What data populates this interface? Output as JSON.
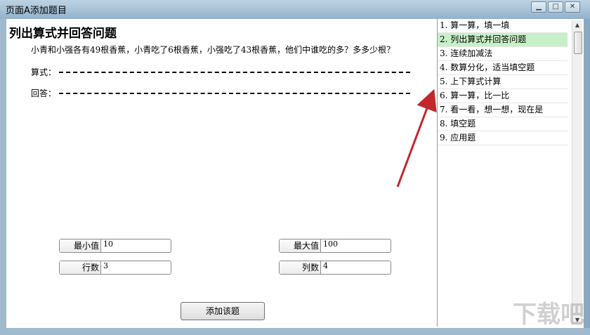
{
  "window": {
    "title": "页面A添加题目"
  },
  "question": {
    "title": "列出算式并回答问题",
    "text": "小青和小强各有49根香蕉，小青吃了6根香蕉，小强吃了43根香蕉，他们中谁吃的多？多多少根？",
    "formula_label": "算式：",
    "answer_label": "回答："
  },
  "params": {
    "min": {
      "label": "最小值",
      "value": "10"
    },
    "max": {
      "label": "最大值",
      "value": "100"
    },
    "rows": {
      "label": "行数",
      "value": "3"
    },
    "cols": {
      "label": "列数",
      "value": "4"
    }
  },
  "add_button": "添加该题",
  "list": {
    "items": [
      "1. 算一算，填一填",
      "2. 列出算式并回答问题",
      "3. 连续加减法",
      "4. 数算分化，适当填空题",
      "5. 上下算式计算",
      "6. 算一算，比一比",
      "7. 看一看，想一想，现在是",
      "8. 填空题",
      "9. 应用题"
    ],
    "selected_index": 1
  },
  "colors": {
    "selected": "#c8f0c8",
    "arrow": "#c0282c"
  },
  "watermark": "下载吧"
}
